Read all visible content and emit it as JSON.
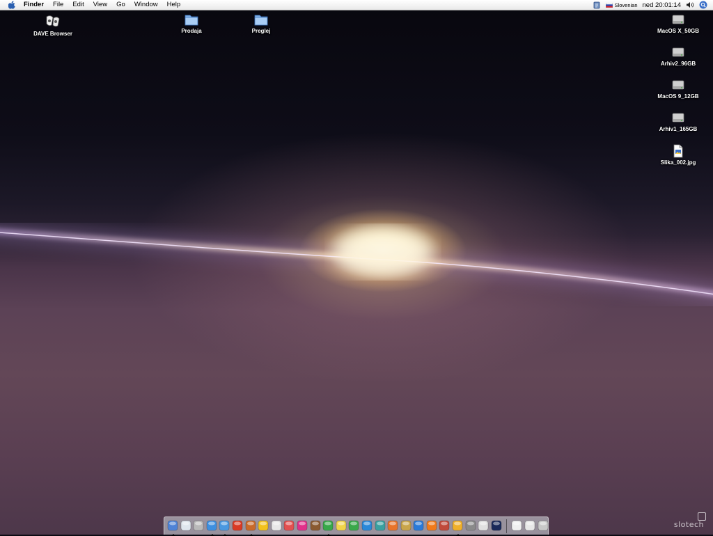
{
  "menubar": {
    "app_name": "Finder",
    "menus": [
      "File",
      "Edit",
      "View",
      "Go",
      "Window",
      "Help"
    ],
    "input_language": "Slovenian",
    "clock": "ned 20:01:14",
    "icons": [
      "apple-icon",
      "script-menu-icon",
      "flag-icon",
      "volume-icon",
      "spotlight-icon"
    ]
  },
  "desktop_icons": [
    {
      "label": "DAVE Browser",
      "icon": "dave-browser-icon"
    },
    {
      "label": "Prodaja",
      "icon": "folder-icon"
    },
    {
      "label": "Preglej",
      "icon": "folder-icon"
    },
    {
      "label": "MacOS X_50GB",
      "icon": "hard-drive-icon"
    },
    {
      "label": "Arhiv2_96GB",
      "icon": "hard-drive-icon"
    },
    {
      "label": "MacOS 9_12GB",
      "icon": "hard-drive-icon"
    },
    {
      "label": "Arhiv1_165GB",
      "icon": "hard-drive-icon"
    },
    {
      "label": "Slika_002.jpg",
      "icon": "image-file-icon"
    }
  ],
  "dock": {
    "apps": [
      {
        "icon": "finder-icon",
        "color": "#4f83d6",
        "running": true
      },
      {
        "icon": "mail-icon",
        "color": "#dfe6ee",
        "running": false
      },
      {
        "icon": "text-document-icon",
        "color": "#b9b9b9",
        "running": false
      },
      {
        "icon": "safari-compass-icon",
        "color": "#3d8fe0",
        "running": true
      },
      {
        "icon": "network-globe-icon",
        "color": "#4a98e0",
        "running": true
      },
      {
        "icon": "tomato-icon",
        "color": "#d93a24",
        "running": false
      },
      {
        "icon": "fox-icon",
        "color": "#c96a2a",
        "running": true
      },
      {
        "icon": "duck-icon",
        "color": "#f2c21d",
        "running": false
      },
      {
        "icon": "acrobat-icon",
        "color": "#e8e8e8",
        "running": false
      },
      {
        "icon": "acrobat-reader-icon",
        "color": "#e35050",
        "running": false
      },
      {
        "icon": "flower-icon",
        "color": "#e0308a",
        "running": false
      },
      {
        "icon": "paint-brush-icon",
        "color": "#8a5a30",
        "running": false
      },
      {
        "icon": "pencil-icon",
        "color": "#38a84a",
        "running": true
      },
      {
        "icon": "checkmark-icon",
        "color": "#f0d44a",
        "running": false
      },
      {
        "icon": "dreamweaver-icon",
        "color": "#3aa84a",
        "running": false
      },
      {
        "icon": "indesign-icon",
        "color": "#2a88d8",
        "running": false
      },
      {
        "icon": "butterfly-icon",
        "color": "#3aa0a0",
        "running": false
      },
      {
        "icon": "photoshop-icon",
        "color": "#e8742a",
        "running": false
      },
      {
        "icon": "book-icon",
        "color": "#c9a54a",
        "running": false
      },
      {
        "icon": "sphere-icon",
        "color": "#2a7ad8",
        "running": false
      },
      {
        "icon": "traffic-cone-icon",
        "color": "#f07a1a",
        "running": false
      },
      {
        "icon": "magnifier-icon",
        "color": "#c04a3a",
        "running": false
      },
      {
        "icon": "cd-burner-icon",
        "color": "#f0b02a",
        "running": true
      },
      {
        "icon": "system-preferences-icon",
        "color": "#8a8a8a",
        "running": false
      },
      {
        "icon": "bluetooth-icon",
        "color": "#e0e0e0",
        "running": false
      },
      {
        "icon": "terminal-icon",
        "color": "#1a2a5a",
        "running": false
      }
    ],
    "docs": [
      {
        "icon": "window-icon",
        "color": "#f0f0f0"
      },
      {
        "icon": "document-stack-icon",
        "color": "#e8e8e8"
      },
      {
        "icon": "trash-icon",
        "color": "#c8c8c8"
      }
    ]
  },
  "watermark": "slotech"
}
